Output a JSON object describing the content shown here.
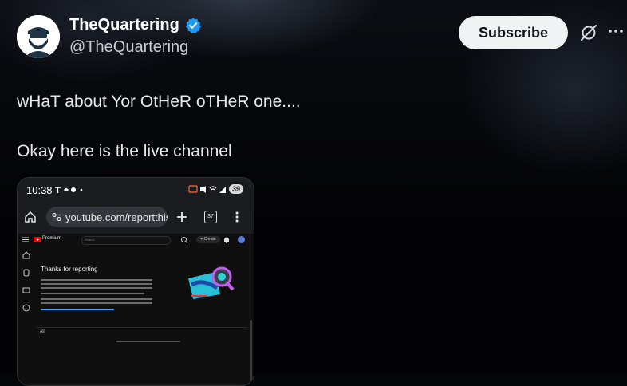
{
  "post": {
    "display_name": "TheQuartering",
    "handle": "@TheQuartering",
    "verified_icon": "verified-badge-icon",
    "subscribe_label": "Subscribe",
    "text_line1": "wHaT about Yor OtHeR oTHeR one....",
    "text_line2": "Okay here is the live channel"
  },
  "screenshot": {
    "status_time": "10:38",
    "battery": "39",
    "url": "youtube.com/reportthistory",
    "tab_count": "37",
    "yt_brand": "Premium",
    "search_placeholder": "Search",
    "create_label": "+ Create",
    "report_title": "Thanks for reporting",
    "filter_label": "All",
    "empty_message": "You haven't submitted any reports"
  },
  "colors": {
    "accent_verified": "#1d9bf0",
    "subscribe_bg": "#eff3f4",
    "youtube_red": "#ff0000"
  }
}
